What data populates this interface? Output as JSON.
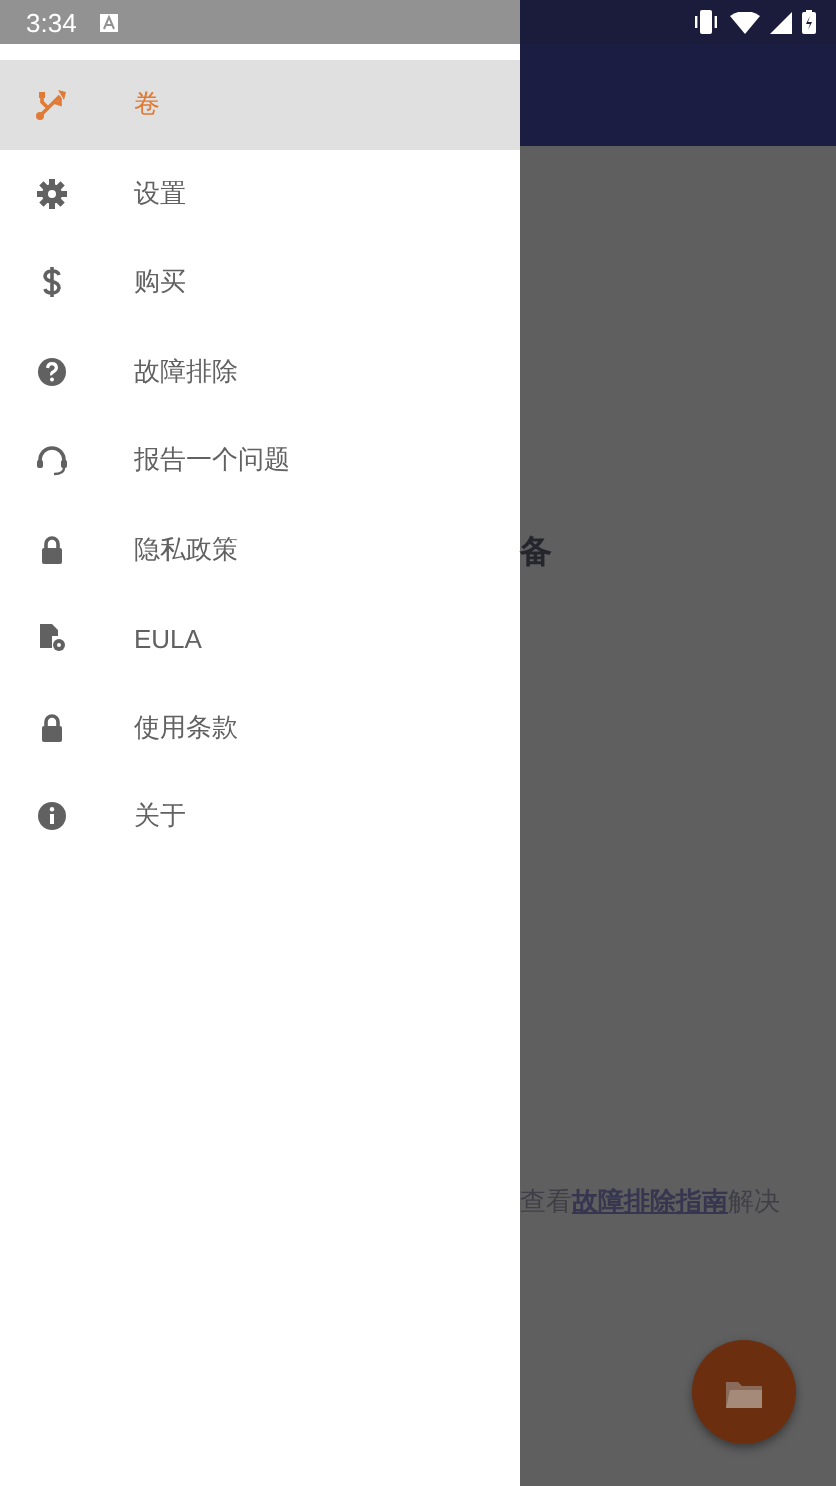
{
  "status_bar": {
    "time": "3:34"
  },
  "drawer": {
    "items": [
      {
        "label": "卷",
        "selected": true
      },
      {
        "label": "设置",
        "selected": false
      },
      {
        "label": "购买",
        "selected": false
      },
      {
        "label": "故障排除",
        "selected": false
      },
      {
        "label": "报告一个问题",
        "selected": false
      },
      {
        "label": "隐私政策",
        "selected": false
      },
      {
        "label": "EULA",
        "selected": false
      },
      {
        "label": "使用条款",
        "selected": false
      },
      {
        "label": "关于",
        "selected": false
      }
    ]
  },
  "background_screen": {
    "heading": "备",
    "message": {
      "before": "查看",
      "link": "故障排除指南",
      "after": "解决"
    }
  }
}
